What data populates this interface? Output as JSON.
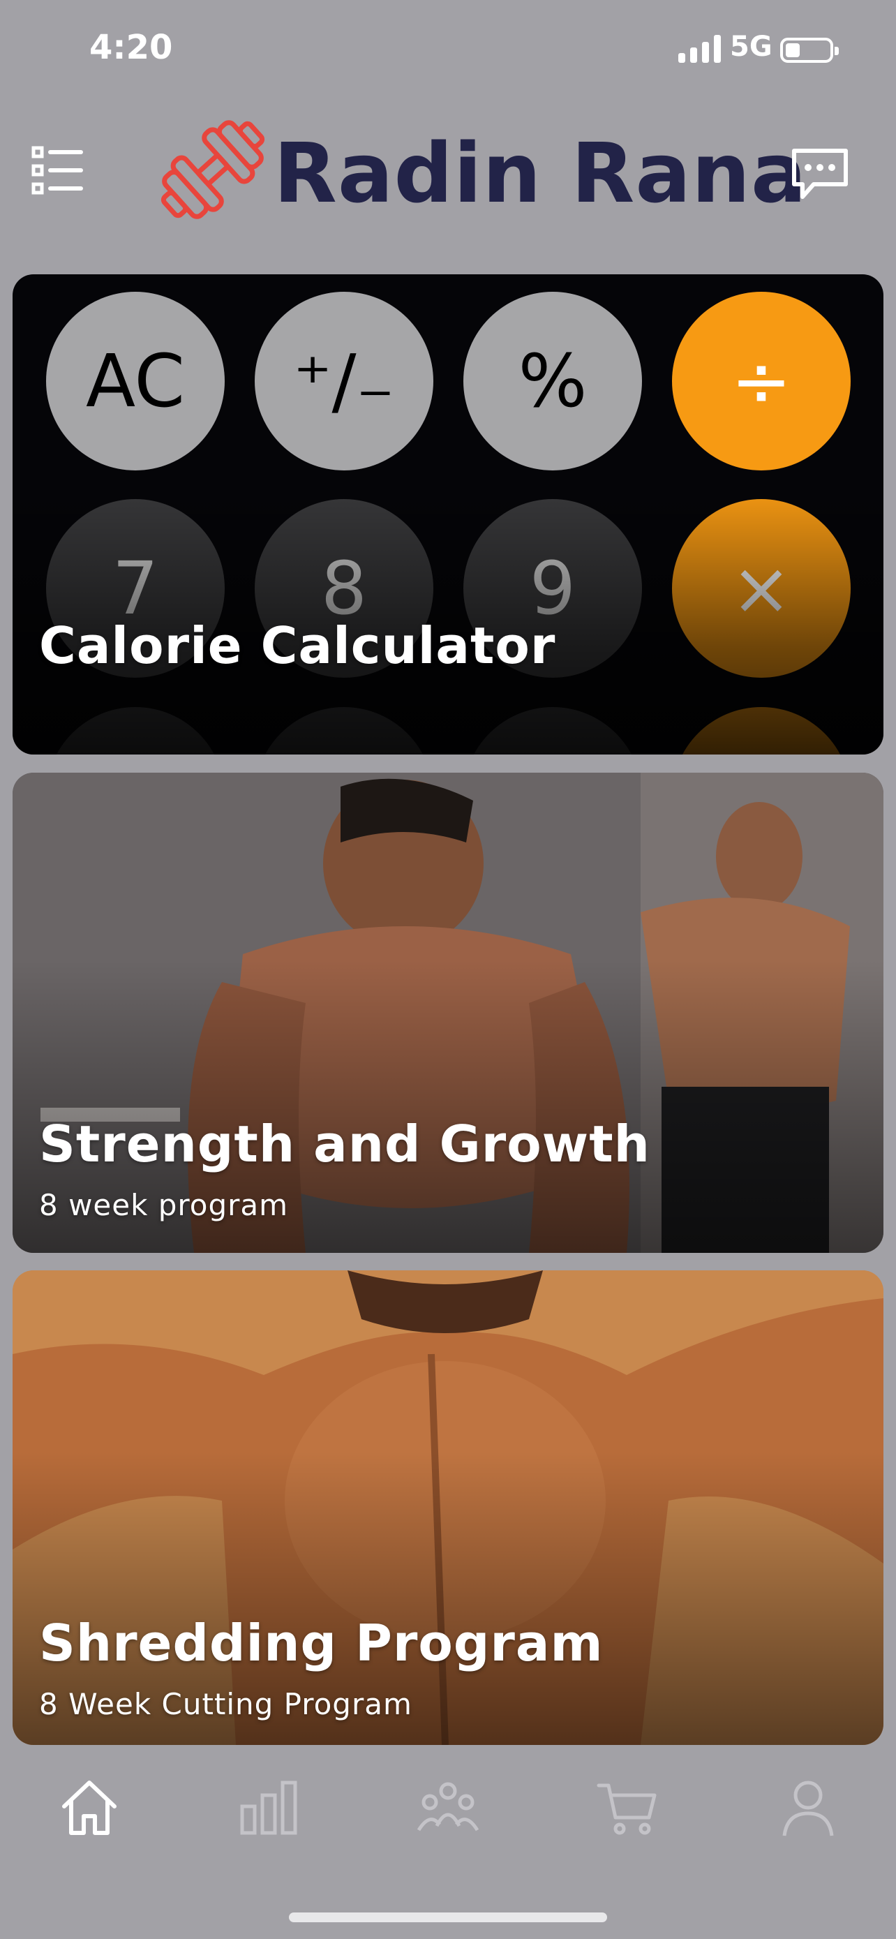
{
  "status": {
    "time": "4:20",
    "network": "5G"
  },
  "header": {
    "brand": "Radin Rana",
    "logo_icon": "dumbbell-icon",
    "brand_color": "#222348",
    "logo_color": "#e8453c"
  },
  "cards": [
    {
      "title": "Calorie Calculator",
      "keys_row1": [
        "AC",
        "⁺∕₋",
        "%",
        "÷"
      ],
      "keys_row2": [
        "7",
        "8",
        "9",
        "×"
      ]
    },
    {
      "title": "Strength and Growth",
      "subtitle": "8 week program"
    },
    {
      "title": "Shredding Program",
      "subtitle": "8 Week Cutting Program"
    }
  ],
  "tabs": [
    "home-icon",
    "stats-icon",
    "community-icon",
    "cart-icon",
    "profile-icon"
  ],
  "colors": {
    "background": "#a2a1a6",
    "accent_orange": "#f79a13"
  }
}
